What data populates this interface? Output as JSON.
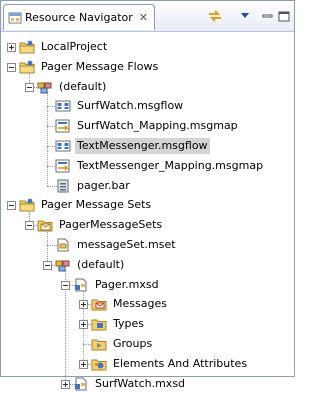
{
  "view": {
    "title": "Resource Navigator",
    "close_glyph": "✕",
    "toolbar": [
      "sync-arrows-icon",
      "view-menu-dropdown-icon",
      "minimize-icon",
      "maximize-icon"
    ]
  },
  "tree": [
    {
      "label": "LocalProject",
      "icon": "project-folder-icon",
      "expander": "plus"
    },
    {
      "label": "Pager Message Flows",
      "icon": "project-folder-icon",
      "expander": "minus"
    },
    {
      "label": "(default)",
      "icon": "package-icon",
      "expander": "minus"
    },
    {
      "label": "SurfWatch.msgflow",
      "icon": "msgflow-icon"
    },
    {
      "label": "SurfWatch_Mapping.msgmap",
      "icon": "msgmap-icon"
    },
    {
      "label": "TextMessenger.msgflow",
      "icon": "msgflow-icon",
      "selected": true
    },
    {
      "label": "TextMessenger_Mapping.msgmap",
      "icon": "msgmap-icon"
    },
    {
      "label": "pager.bar",
      "icon": "bar-file-icon"
    },
    {
      "label": "Pager Message Sets",
      "icon": "project-folder-icon",
      "expander": "minus"
    },
    {
      "label": "PagerMessageSets",
      "icon": "message-set-folder-icon",
      "expander": "minus"
    },
    {
      "label": "messageSet.mset",
      "icon": "mset-file-icon"
    },
    {
      "label": "(default)",
      "icon": "package-icon",
      "expander": "minus"
    },
    {
      "label": "Pager.mxsd",
      "icon": "mxsd-file-icon",
      "expander": "minus"
    },
    {
      "label": "Messages",
      "icon": "messages-icon",
      "expander": "plus"
    },
    {
      "label": "Types",
      "icon": "types-icon",
      "expander": "plus"
    },
    {
      "label": "Groups",
      "icon": "groups-icon"
    },
    {
      "label": "Elements And Attributes",
      "icon": "elements-icon",
      "expander": "plus"
    },
    {
      "label": "SurfWatch.mxsd",
      "icon": "mxsd-file-icon",
      "expander": "plus"
    }
  ]
}
